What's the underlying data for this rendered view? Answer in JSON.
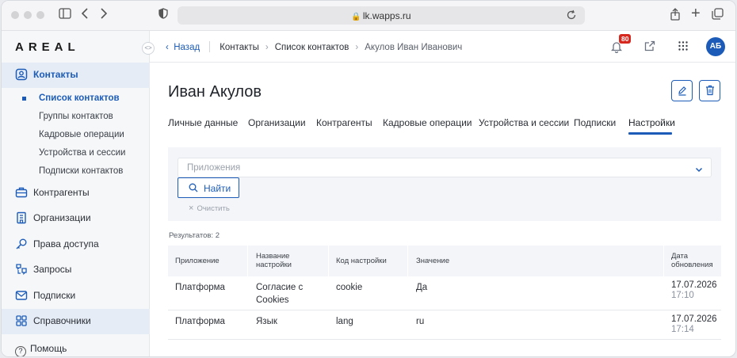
{
  "browser": {
    "url": "lk.wapps.ru"
  },
  "sidebar": {
    "logo": "AREAL",
    "collapse_glyph": "<>",
    "items": [
      {
        "label": "Контакты",
        "icon": "contact-icon",
        "active": true
      },
      {
        "label": "Контрагенты",
        "icon": "briefcase-icon"
      },
      {
        "label": "Организации",
        "icon": "building-icon"
      },
      {
        "label": "Права доступа",
        "icon": "key-icon"
      },
      {
        "label": "Запросы",
        "icon": "requests-icon"
      },
      {
        "label": "Подписки",
        "icon": "mail-icon"
      },
      {
        "label": "Справочники",
        "icon": "grid-icon"
      }
    ],
    "subitems": [
      {
        "label": "Список контактов",
        "active": true
      },
      {
        "label": "Группы контактов"
      },
      {
        "label": "Кадровые операции"
      },
      {
        "label": "Устройства и сессии"
      },
      {
        "label": "Подписки контактов"
      }
    ],
    "help_label": "Помощь"
  },
  "topbar": {
    "back_label": "Назад",
    "breadcrumbs": [
      "Контакты",
      "Список контактов",
      "Акулов Иван Иванович"
    ],
    "notifications_count": "80",
    "avatar_initials": "АБ"
  },
  "page": {
    "title": "Иван Акулов",
    "tabs": [
      {
        "label": "Личные данные"
      },
      {
        "label": "Организации"
      },
      {
        "label": "Контрагенты"
      },
      {
        "label": "Кадровые операции"
      },
      {
        "label": "Устройства и сессии"
      },
      {
        "label": "Подписки"
      },
      {
        "label": "Настройки",
        "active": true
      }
    ]
  },
  "filter": {
    "select_placeholder": "Приложения",
    "find_label": "Найти",
    "clear_label": "Очистить"
  },
  "results_label": "Результатов: 2",
  "table": {
    "columns": [
      {
        "label": "Приложение"
      },
      {
        "line1": "Название",
        "line2": "настройки"
      },
      {
        "label": "Код настройки"
      },
      {
        "label": "Значение"
      },
      {
        "line1": "Дата",
        "line2": "обновления"
      }
    ],
    "rows": [
      {
        "app": "Платформа",
        "name_line1": "Согласие с",
        "name_line2": "Cookies",
        "code": "cookie",
        "value": "Да",
        "date": "17.07.2026",
        "time": "17:10"
      },
      {
        "app": "Платформа",
        "name_line1": "Язык",
        "name_line2": "",
        "code": "lang",
        "value": "ru",
        "date": "17.07.2026",
        "time": "17:14"
      }
    ]
  },
  "colors": {
    "accent": "#1c5cb8",
    "badge": "#d6281e"
  }
}
